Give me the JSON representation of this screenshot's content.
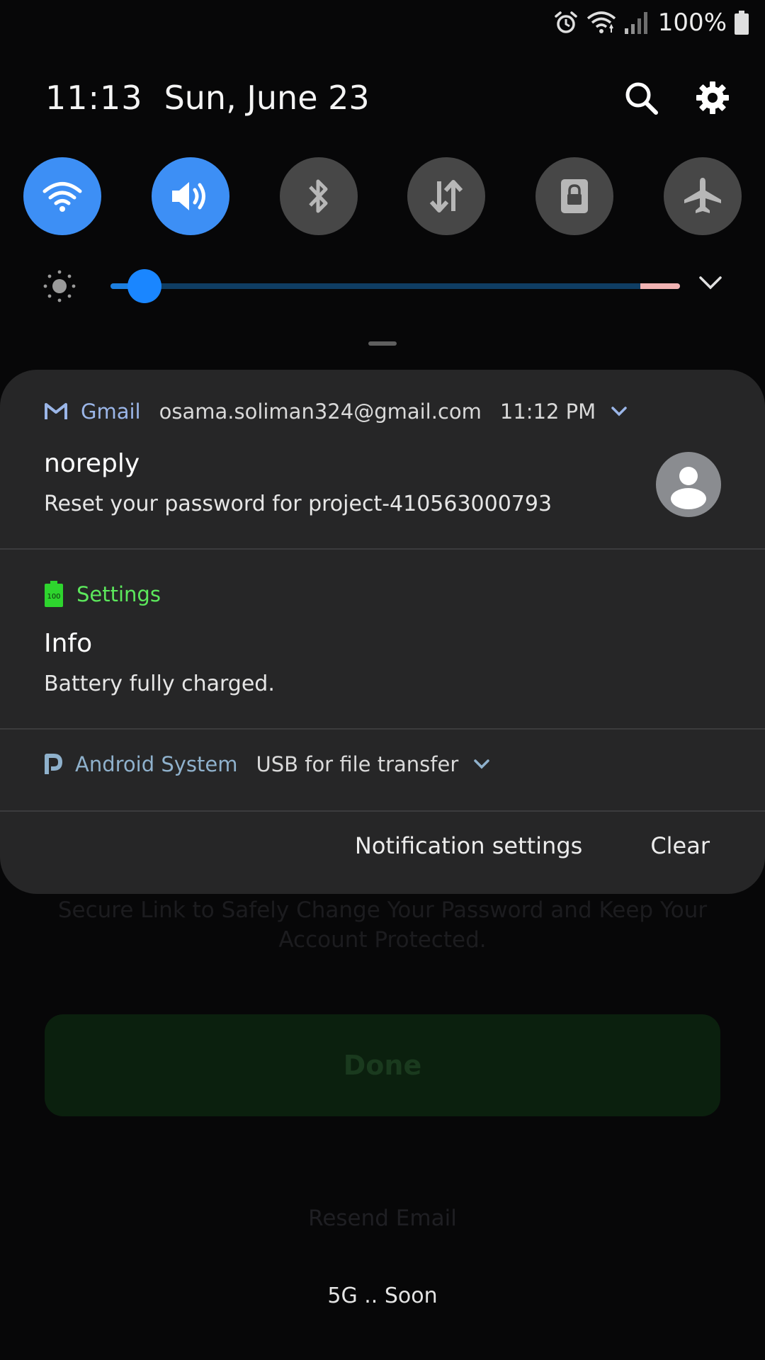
{
  "status_bar": {
    "battery_percent": "100%",
    "icons": [
      "alarm-icon",
      "wifi-icon",
      "signal-icon",
      "battery-icon"
    ]
  },
  "header": {
    "time": "11:13",
    "date": "Sun, June 23",
    "actions": [
      "search-icon",
      "gear-icon"
    ]
  },
  "quick_toggles": [
    {
      "icon": "wifi-icon",
      "state": "on"
    },
    {
      "icon": "sound-icon",
      "state": "on"
    },
    {
      "icon": "bluetooth-icon",
      "state": "off"
    },
    {
      "icon": "mobile-data-icon",
      "state": "off"
    },
    {
      "icon": "screen-lock-icon",
      "state": "off"
    },
    {
      "icon": "airplane-icon",
      "state": "off"
    }
  ],
  "brightness": {
    "level": 0.06,
    "high_zone_start": 0.93
  },
  "notifications": [
    {
      "app": "Gmail",
      "account": "osama.soliman324@gmail.com",
      "time": "11:12 PM",
      "title": "noreply",
      "text": "Reset your password for project-410563000793",
      "icon": "gmail-icon",
      "avatar": "person-avatar-icon"
    },
    {
      "app": "Settings",
      "battery_badge": "100",
      "title": "Info",
      "text": "Battery fully charged.",
      "icon": "battery-charged-icon"
    },
    {
      "app": "Android System",
      "summary": "USB for file transfer",
      "icon": "android-system-icon"
    }
  ],
  "panel_footer": {
    "notification_settings": "Notification settings",
    "clear": "Clear"
  },
  "background_app": {
    "message": "Secure Link to Safely Change Your Password and Keep Your Account Protected.",
    "done_button": "Done",
    "resend_link": "Resend Email",
    "footer_label": "5G .. Soon"
  },
  "colors": {
    "toggle_on": "#3d8ff5",
    "toggle_off": "#474747",
    "panel": "#262627",
    "gmail_name": "#9bb6e8",
    "settings_name": "#5ce85c",
    "android_name": "#8fb1cc"
  }
}
